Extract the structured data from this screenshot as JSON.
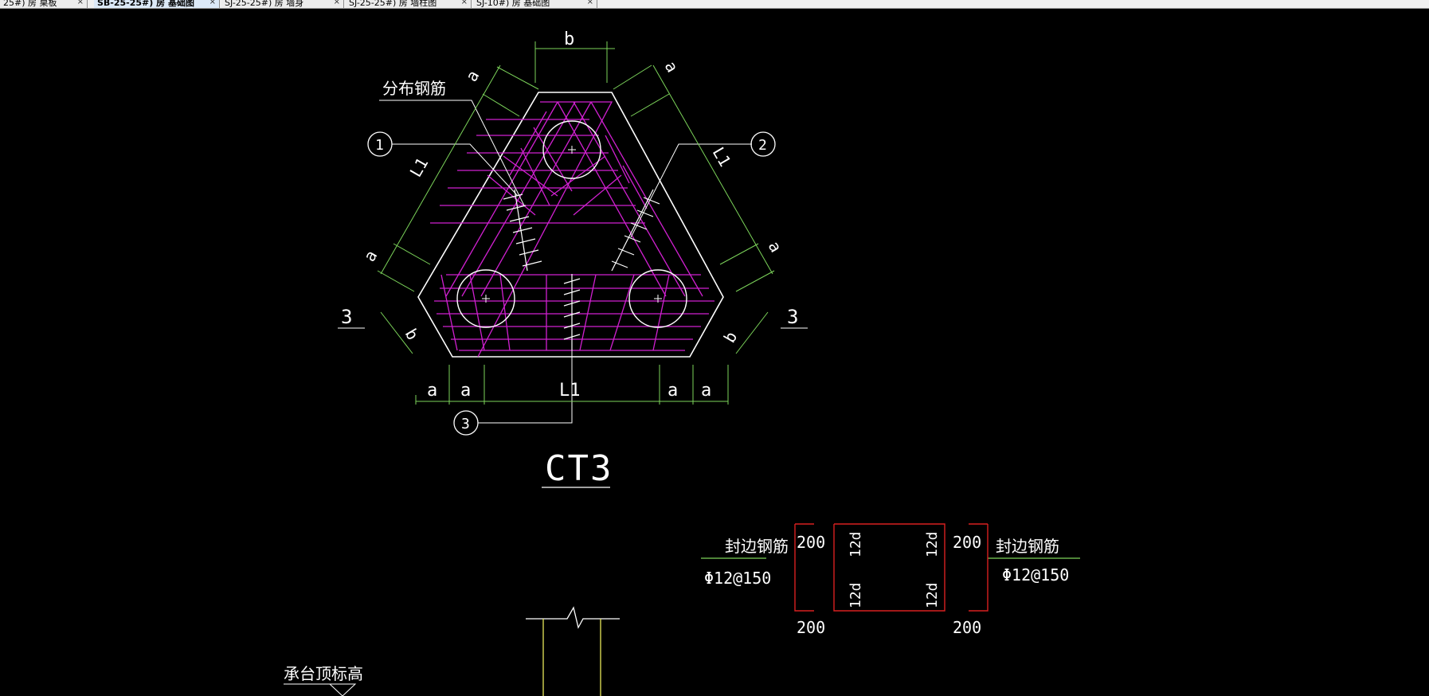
{
  "tabs": [
    {
      "label": "25#) 房 桌板",
      "active": false
    },
    {
      "label": "SB-25-25#) 房 基础图",
      "active": true
    },
    {
      "label": "SJ-25-25#) 房 墙身",
      "active": false
    },
    {
      "label": "SJ-25-25#) 房 墙柱图",
      "active": false
    },
    {
      "label": "SJ-10#) 房 基础图",
      "active": false
    }
  ],
  "tab_close_glyph": "×",
  "colors": {
    "background": "#000000",
    "outline": "#ffffff",
    "rebar": "#d020d0",
    "dimension": "#7cd45a",
    "section_box": "#d82020",
    "yellow_line": "#e8e85a"
  },
  "drawing": {
    "title": "CT3",
    "distribution_rebar_label": "分布钢筋",
    "circle_markers": [
      "1",
      "2",
      "3"
    ],
    "section_marks": [
      "3",
      "3"
    ],
    "dimensions": {
      "top_b": "b",
      "left_top_a": "a",
      "left_l1": "L1",
      "left_bottom_a": "a",
      "right_top_a": "a",
      "right_l1": "L1",
      "right_bottom_a": "a",
      "left_b": "b",
      "right_b": "b",
      "bottom_labels": [
        "a",
        "a",
        "L1",
        "a",
        "a"
      ]
    }
  },
  "edge_detail": {
    "left_label": "封边钢筋",
    "left_spec": "Φ12@150",
    "right_label": "封边钢筋",
    "right_spec": "Φ12@150",
    "top_left_dim": "200",
    "top_right_dim": "200",
    "bottom_left_dim": "200",
    "bottom_right_dim": "200",
    "inner_labels": [
      "12d",
      "12d",
      "12d",
      "12d"
    ]
  },
  "pile_detail": {
    "elevation_label": "承台顶标高"
  }
}
